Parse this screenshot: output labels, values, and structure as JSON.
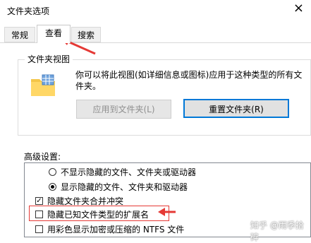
{
  "window": {
    "title": "文件夹选项",
    "close_glyph": "×"
  },
  "tabs": [
    {
      "label": "常规",
      "active": false
    },
    {
      "label": "查看",
      "active": true
    },
    {
      "label": "搜索",
      "active": false
    }
  ],
  "folder_views": {
    "legend": "文件夹视图",
    "description": "你可以将此视图(如详细信息或图标)应用于这种类型的所有文件夹。",
    "apply_button": "应用到文件夹(L)",
    "reset_button": "重置文件夹(R)"
  },
  "advanced": {
    "label": "高级设置:",
    "items": [
      {
        "type": "radio",
        "checked": false,
        "label": "不显示隐藏的文件、文件夹或驱动器"
      },
      {
        "type": "radio",
        "checked": true,
        "label": "显示隐藏的文件、文件夹和驱动器"
      },
      {
        "type": "checkbox",
        "checked": true,
        "label": "隐藏文件夹合并冲突"
      },
      {
        "type": "checkbox",
        "checked": false,
        "label": "隐藏已知文件类型的扩展名"
      },
      {
        "type": "checkbox",
        "checked": false,
        "label": "用彩色显示加密或压缩的 NTFS 文件"
      }
    ]
  },
  "annotation_color": "#e53935",
  "accent_color": "#0078d7",
  "watermark": "知乎 @雨季拾碎"
}
